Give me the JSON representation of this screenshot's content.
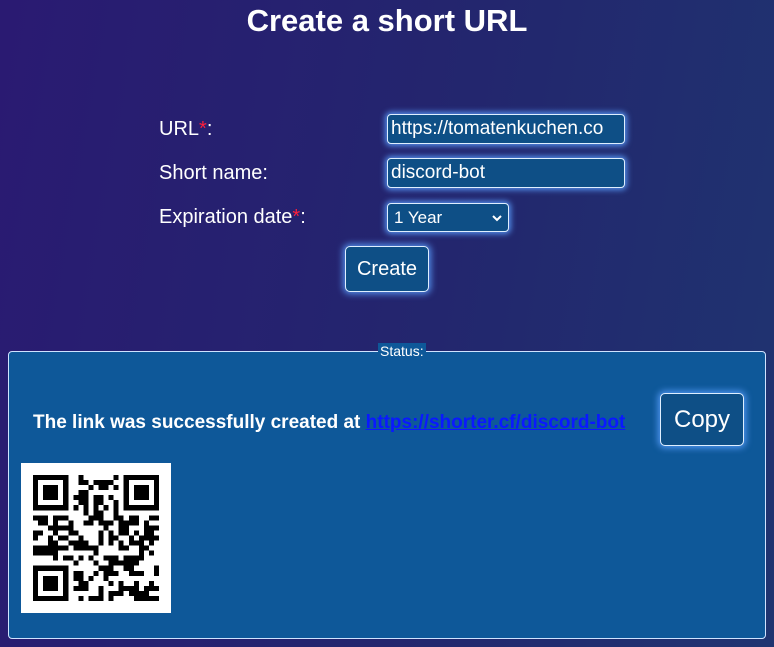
{
  "title": "Create a short URL",
  "form": {
    "url_label": "URL",
    "url_required_mark": "*",
    "url_label_suffix": ":",
    "url_value": "https://tomatenkuchen.co",
    "short_name_label": "Short name:",
    "short_name_value": "discord-bot",
    "expiration_label": "Expiration date",
    "expiration_required_mark": "*",
    "expiration_label_suffix": ":",
    "expiration_selected": "1 Year",
    "create_label": "Create"
  },
  "status": {
    "legend": "Status:",
    "message": "The link was successfully created at",
    "link": "https://shorter.cf/discord-bot",
    "copy_label": "Copy"
  },
  "colors": {
    "required": "#ff1f3a",
    "panel": "#0e5899",
    "link": "#0a18ff"
  },
  "icons": [
    "chevron-down-icon",
    "qr-code"
  ]
}
